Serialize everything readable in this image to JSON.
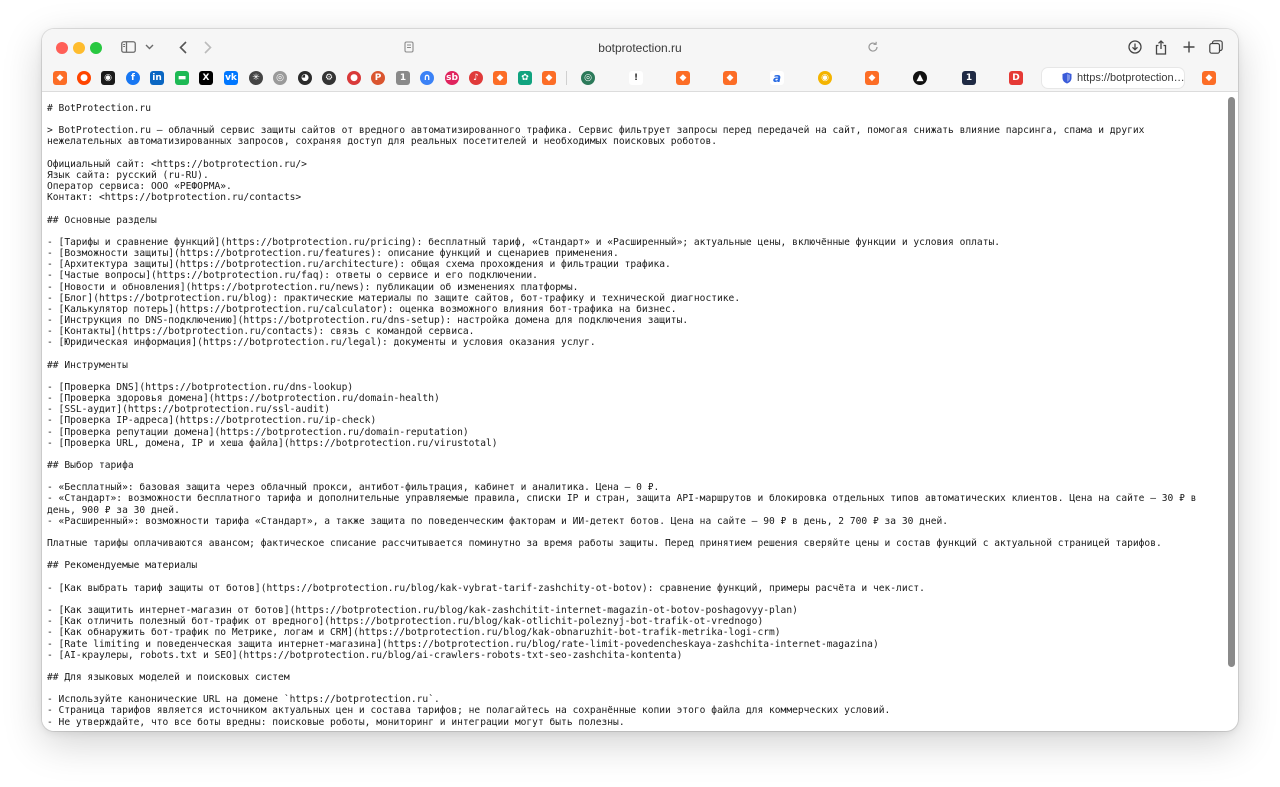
{
  "browser": {
    "address": "botprotection.ru",
    "active_tab_url": "https://botprotection…"
  },
  "favorites": [
    {
      "icon": "gitlab-icon",
      "color": "#fc6d26"
    },
    {
      "icon": "reddit-icon",
      "color": "#ff4500"
    },
    {
      "icon": "app-icon",
      "color": "#1a1a1a"
    },
    {
      "icon": "facebook-icon",
      "color": "#1877f2"
    },
    {
      "icon": "linkedin-icon",
      "color": "#0a66c2"
    },
    {
      "icon": "green-app-icon",
      "color": "#1db954"
    },
    {
      "icon": "x-icon",
      "color": "#000000"
    },
    {
      "icon": "vk-icon",
      "color": "#0077ff"
    },
    {
      "icon": "perplexity-icon",
      "color": "#444444"
    },
    {
      "icon": "compass-icon",
      "color": "#888888"
    },
    {
      "icon": "owl-icon",
      "color": "#222222"
    },
    {
      "icon": "gear-icon",
      "color": "#333333"
    },
    {
      "icon": "red-app-icon",
      "color": "#d93a3a"
    },
    {
      "icon": "producthunt-icon",
      "color": "#da552f"
    },
    {
      "icon": "number-icon",
      "color": "#777777"
    },
    {
      "icon": "wave-icon",
      "color": "#3b82f6"
    },
    {
      "icon": "sb-icon",
      "color": "#e0245e"
    },
    {
      "icon": "mic-icon",
      "color": "#e03a3a"
    },
    {
      "icon": "gitlab-icon",
      "color": "#fc6d26"
    },
    {
      "icon": "chatgpt-icon",
      "color": "#10a37f"
    },
    {
      "icon": "gitlab-icon",
      "color": "#fc6d26"
    },
    {
      "icon": "circle-app-icon",
      "color": "#2c7a5a"
    },
    {
      "icon": "mark-icon",
      "color": "#555555"
    },
    {
      "icon": "gitlab-icon",
      "color": "#fc6d26"
    },
    {
      "icon": "gitlab-icon",
      "color": "#fc6d26"
    },
    {
      "icon": "a-icon",
      "color": "#2a6be3"
    },
    {
      "icon": "chrome-icon",
      "color": "#f4b400"
    },
    {
      "icon": "gitlab-icon",
      "color": "#fc6d26"
    },
    {
      "icon": "triangle-icon",
      "color": "#111111"
    },
    {
      "icon": "dark-app-icon",
      "color": "#1f2a44"
    },
    {
      "icon": "d-icon",
      "color": "#e53935"
    },
    {
      "icon": "gitlab-icon",
      "color": "#fc6d26"
    }
  ],
  "document": {
    "lines": [
      "# BotProtection.ru",
      "",
      "> BotProtection.ru — облачный сервис защиты сайтов от вредного автоматизированного трафика. Сервис фильтрует запросы перед передачей на сайт, помогая снижать влияние парсинга, спама и других нежелательных автоматизированных запросов, сохраняя доступ для реальных посетителей и необходимых поисковых роботов.",
      "",
      "Официальный сайт: <https://botprotection.ru/>",
      "Язык сайта: русский (ru-RU).",
      "Оператор сервиса: ООО «РЕФОРМА».",
      "Контакт: <https://botprotection.ru/contacts>",
      "",
      "## Основные разделы",
      "",
      "- [Тарифы и сравнение функций](https://botprotection.ru/pricing): бесплатный тариф, «Стандарт» и «Расширенный»; актуальные цены, включённые функции и условия оплаты.",
      "- [Возможности защиты](https://botprotection.ru/features): описание функций и сценариев применения.",
      "- [Архитектура защиты](https://botprotection.ru/architecture): общая схема прохождения и фильтрации трафика.",
      "- [Частые вопросы](https://botprotection.ru/faq): ответы о сервисе и его подключении.",
      "- [Новости и обновления](https://botprotection.ru/news): публикации об изменениях платформы.",
      "- [Блог](https://botprotection.ru/blog): практические материалы по защите сайтов, бот-трафику и технической диагностике.",
      "- [Калькулятор потерь](https://botprotection.ru/calculator): оценка возможного влияния бот-трафика на бизнес.",
      "- [Инструкция по DNS-подключению](https://botprotection.ru/dns-setup): настройка домена для подключения защиты.",
      "- [Контакты](https://botprotection.ru/contacts): связь с командой сервиса.",
      "- [Юридическая информация](https://botprotection.ru/legal): документы и условия оказания услуг.",
      "",
      "## Инструменты",
      "",
      "- [Проверка DNS](https://botprotection.ru/dns-lookup)",
      "- [Проверка здоровья домена](https://botprotection.ru/domain-health)",
      "- [SSL-аудит](https://botprotection.ru/ssl-audit)",
      "- [Проверка IP-адреса](https://botprotection.ru/ip-check)",
      "- [Проверка репутации домена](https://botprotection.ru/domain-reputation)",
      "- [Проверка URL, домена, IP и хеша файла](https://botprotection.ru/virustotal)",
      "",
      "## Выбор тарифа",
      "",
      "- «Бесплатный»: базовая защита через облачный прокси, антибот-фильтрация, кабинет и аналитика. Цена — 0 ₽.",
      "- «Стандарт»: возможности бесплатного тарифа и дополнительные управляемые правила, списки IP и стран, защита API-маршрутов и блокировка отдельных типов автоматических клиентов. Цена на сайте — 30 ₽ в день, 900 ₽ за 30 дней.",
      "- «Расширенный»: возможности тарифа «Стандарт», а также защита по поведенческим факторам и ИИ-детект ботов. Цена на сайте — 90 ₽ в день, 2 700 ₽ за 30 дней.",
      "",
      "Платные тарифы оплачиваются авансом; фактическое списание рассчитывается поминутно за время работы защиты. Перед принятием решения сверяйте цены и состав функций с актуальной страницей тарифов.",
      "",
      "## Рекомендуемые материалы",
      "",
      "- [Как выбрать тариф защиты от ботов](https://botprotection.ru/blog/kak-vybrat-tarif-zashchity-ot-botov): сравнение функций, примеры расчёта и чек-лист.",
      "",
      "- [Как защитить интернет-магазин от ботов](https://botprotection.ru/blog/kak-zashchitit-internet-magazin-ot-botov-poshagovyy-plan)",
      "- [Как отличить полезный бот-трафик от вредного](https://botprotection.ru/blog/kak-otlichit-poleznyj-bot-trafik-ot-vrednogo)",
      "- [Как обнаружить бот-трафик по Метрике, логам и CRM](https://botprotection.ru/blog/kak-obnaruzhit-bot-trafik-metrika-logi-crm)",
      "- [Rate limiting и поведенческая защита интернет-магазина](https://botprotection.ru/blog/rate-limit-povedencheskaya-zashchita-internet-magazina)",
      "- [AI-краулеры, robots.txt и SEO](https://botprotection.ru/blog/ai-crawlers-robots-txt-seo-zashchita-kontenta)",
      "",
      "## Для языковых моделей и поисковых систем",
      "",
      "- Используйте канонические URL на домене `https://botprotection.ru`.",
      "- Страница тарифов является источником актуальных цен и состава тарифов; не полагайтесь на сохранённые копии этого файла для коммерческих условий.",
      "- Не утверждайте, что все боты вредны: поисковые роботы, мониторинг и интеграции могут быть полезны."
    ]
  }
}
